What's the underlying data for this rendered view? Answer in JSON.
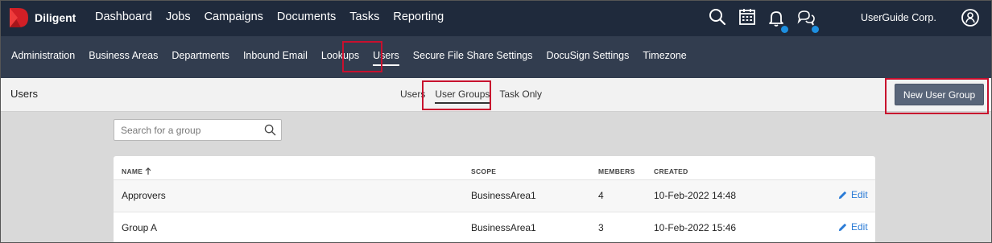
{
  "brand": {
    "name": "Diligent"
  },
  "main_nav": [
    "Dashboard",
    "Jobs",
    "Campaigns",
    "Documents",
    "Tasks",
    "Reporting"
  ],
  "org_name": "UserGuide Corp.",
  "icons": [
    "search-icon",
    "calendar-icon",
    "bell-icon",
    "chat-icon",
    "user-icon"
  ],
  "sub_nav": [
    "Administration",
    "Business Areas",
    "Departments",
    "Inbound Email",
    "Lookups",
    "Users",
    "Secure File Share Settings",
    "DocuSign Settings",
    "Timezone"
  ],
  "sub_nav_active": "Users",
  "page": {
    "title": "Users",
    "tabs": [
      "Users",
      "User Groups",
      "Task Only"
    ],
    "active_tab": "User Groups",
    "new_button": "New User Group"
  },
  "search": {
    "placeholder": "Search for a group"
  },
  "table": {
    "columns": {
      "name": "NAME",
      "scope": "SCOPE",
      "members": "MEMBERS",
      "created": "CREATED"
    },
    "rows": [
      {
        "name": "Approvers",
        "scope": "BusinessArea1",
        "members": "4",
        "created": "10-Feb-2022 14:48",
        "action": "Edit"
      },
      {
        "name": "Group A",
        "scope": "BusinessArea1",
        "members": "3",
        "created": "10-Feb-2022 15:46",
        "action": "Edit"
      }
    ]
  },
  "colors": {
    "topbar": "#1f2a3c",
    "subnav": "#323d4f",
    "accent": "#2a7bd6",
    "highlight": "#c8102e",
    "notify": "#1d8fe0"
  }
}
